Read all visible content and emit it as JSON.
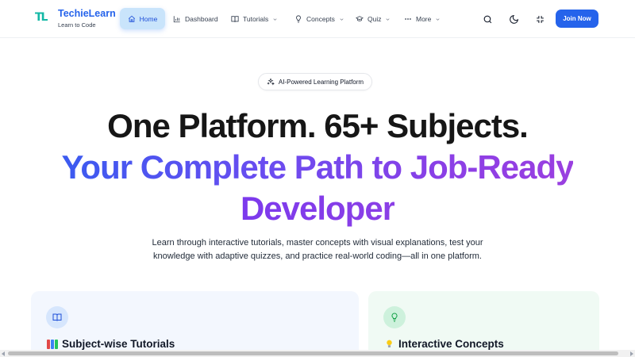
{
  "navbar": {
    "logo": {
      "mark": "TL",
      "title": "TechieLearn",
      "subtitle": "Learn to Code"
    },
    "items": [
      {
        "label": "Home",
        "icon": "home-icon",
        "active": true
      },
      {
        "label": "Dashboard",
        "icon": "bar-chart-icon"
      },
      {
        "label": "Tutorials",
        "icon": "book-icon",
        "dropdown": true
      },
      {
        "label": "Concepts",
        "icon": "lightbulb-icon",
        "dropdown": true
      },
      {
        "label": "Quiz",
        "icon": "graduation-cap-icon",
        "dropdown": true
      },
      {
        "label": "More",
        "icon": "ellipsis-icon",
        "dropdown": true
      }
    ],
    "actions": {
      "search_icon": "search-icon",
      "theme_icon": "moon-icon",
      "collapse_icon": "minimize-icon",
      "join_label": "Join Now"
    }
  },
  "hero": {
    "badge": "AI-Powered Learning Platform",
    "line1": "One Platform. 65+ Subjects.",
    "line2": "Your Complete Path to Job-Ready",
    "line3": "Developer",
    "description": "Learn through interactive tutorials, master concepts with visual explanations, test your knowledge with adaptive quizzes, and practice real-world coding—all in one platform."
  },
  "cards": [
    {
      "title": "Subject-wise Tutorials",
      "icon": "book-open-icon",
      "emoji": "books"
    },
    {
      "title": "Interactive Concepts",
      "icon": "lightbulb-icon",
      "emoji": "light-bulb"
    }
  ],
  "colors": {
    "primary": "#2563eb",
    "gradient_start": "#3b5bf0",
    "gradient_end": "#9a3fe0",
    "heading": "#161616"
  }
}
